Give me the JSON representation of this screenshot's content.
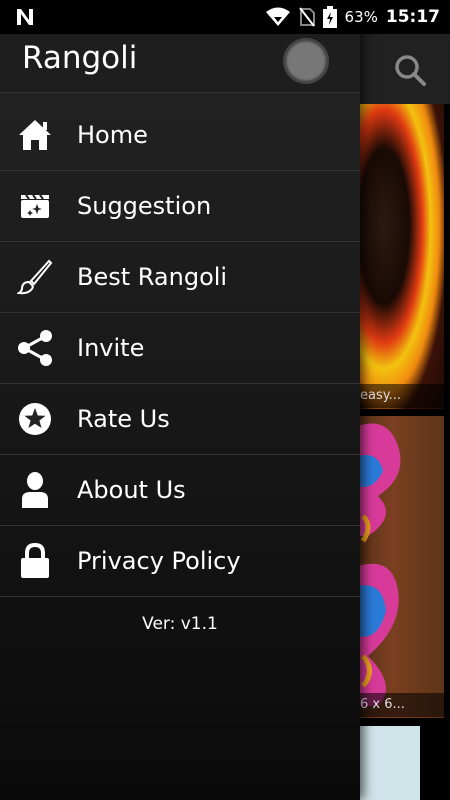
{
  "status_bar": {
    "battery": "63%",
    "time": "15:17"
  },
  "background": {
    "card1_caption": "easy...",
    "card2_caption": "6 x 6..."
  },
  "drawer": {
    "title": "Rangoli",
    "menu": [
      {
        "label": "Home",
        "icon": "home-icon"
      },
      {
        "label": "Suggestion",
        "icon": "clapperboard-icon"
      },
      {
        "label": "Best Rangoli",
        "icon": "paintbrush-icon"
      },
      {
        "label": "Invite",
        "icon": "share-icon"
      },
      {
        "label": "Rate Us",
        "icon": "star-icon"
      },
      {
        "label": "About Us",
        "icon": "person-icon"
      },
      {
        "label": "Privacy Policy",
        "icon": "lock-icon"
      }
    ],
    "version": "Ver: v1.1"
  }
}
